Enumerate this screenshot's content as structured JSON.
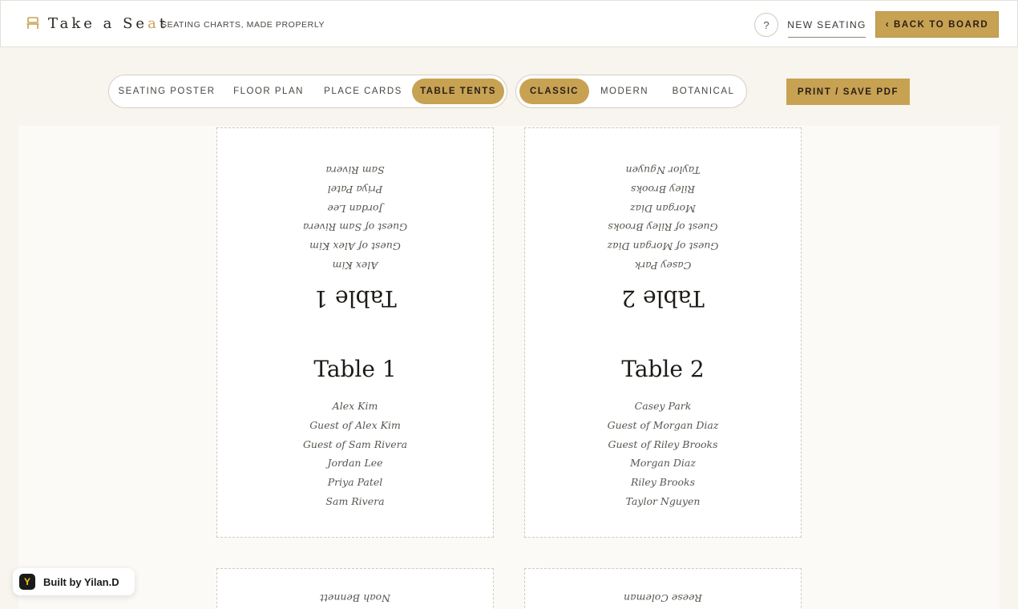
{
  "header": {
    "brand_pre": "Take a Se",
    "brand_accent": "a",
    "brand_post": "t",
    "tagline": "SEATING CHARTS, MADE PROPERLY",
    "help_label": "?",
    "new_seating_label": "NEW SEATING",
    "back_label": "‹ BACK TO BOARD"
  },
  "toolbar": {
    "view_tabs": [
      "SEATING POSTER",
      "FLOOR PLAN",
      "PLACE CARDS",
      "TABLE TENTS"
    ],
    "active_view": "TABLE TENTS",
    "style_tabs": [
      "CLASSIC",
      "MODERN",
      "BOTANICAL"
    ],
    "active_style": "CLASSIC",
    "print_label": "PRINT / SAVE PDF"
  },
  "tents": [
    {
      "name": "Table 1",
      "guests": [
        "Alex Kim",
        "Guest of Alex Kim",
        "Guest of Sam Rivera",
        "Jordan Lee",
        "Priya Patel",
        "Sam Rivera"
      ]
    },
    {
      "name": "Table 2",
      "guests": [
        "Casey Park",
        "Guest of Morgan Diaz",
        "Guest of Riley Brooks",
        "Morgan Diaz",
        "Riley Brooks",
        "Taylor Nguyen"
      ]
    },
    {
      "name": "",
      "guests": [
        "Noah Bennett"
      ]
    },
    {
      "name": "",
      "guests": [
        "Reese Coleman"
      ]
    }
  ],
  "badge": {
    "logo": "Y",
    "text": "Built by Yilan.D"
  },
  "colors": {
    "accent": "#c8a253",
    "background": "#f8f5ef",
    "card": "#ffffff"
  }
}
